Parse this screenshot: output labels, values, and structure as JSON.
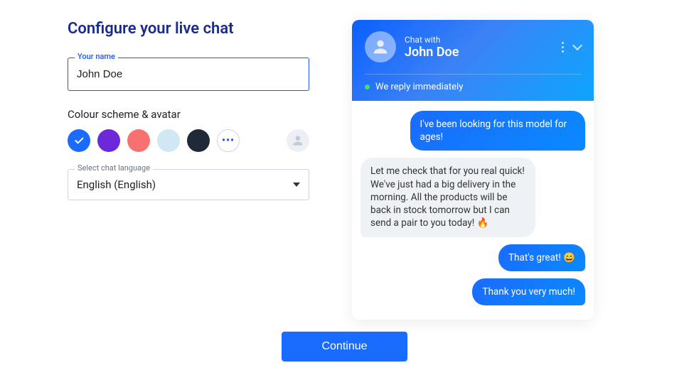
{
  "title": "Configure your live chat",
  "name_field": {
    "label": "Your name",
    "value": "John Doe"
  },
  "colour_section_label": "Colour scheme & avatar",
  "swatches": [
    {
      "color": "#1a6bff",
      "selected": true
    },
    {
      "color": "#6d28d9",
      "selected": false
    },
    {
      "color": "#f87171",
      "selected": false
    },
    {
      "color": "#cfe8f4",
      "selected": false
    },
    {
      "color": "#1f2937",
      "selected": false
    }
  ],
  "more_swatches_label": "•••",
  "language_field": {
    "label": "Select chat language",
    "value": "English (English)"
  },
  "preview": {
    "chat_with_label": "Chat with",
    "operator_name": "John Doe",
    "reply_status": "We reply immediately",
    "messages": [
      {
        "side": "user",
        "text": "I've been looking for this model for ages!"
      },
      {
        "side": "agent",
        "text": "Let me check that for you real quick! We've just had a big delivery in the morning. All the products will be back in stock tomorrow but I can send a pair to you today! 🔥"
      },
      {
        "side": "user",
        "text": "That's great! 😄"
      },
      {
        "side": "user",
        "text": "Thank you very much!"
      }
    ]
  },
  "continue_label": "Continue"
}
